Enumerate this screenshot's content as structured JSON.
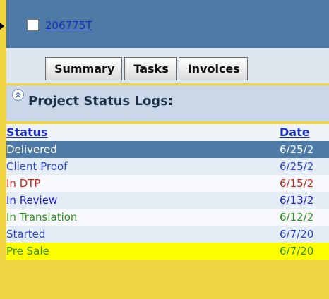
{
  "header": {
    "project_id": "206775T"
  },
  "tabs": [
    {
      "label": "Summary"
    },
    {
      "label": "Tasks"
    },
    {
      "label": "Invoices"
    }
  ],
  "panel": {
    "title": "Project Status Logs:"
  },
  "table": {
    "columns": [
      "Status",
      "Date"
    ],
    "rows": [
      {
        "status": "Delivered",
        "date": "6/25/2",
        "color": "#ffffff"
      },
      {
        "status": "Client Proof",
        "date": "6/25/2",
        "color": "#2b46c7"
      },
      {
        "status": "In DTP",
        "date": "6/15/2",
        "color": "#c0281a"
      },
      {
        "status": "In Review",
        "date": "6/13/2",
        "color": "#1b1fd0"
      },
      {
        "status": "In Translation",
        "date": "6/12/2",
        "color": "#2f8f1c"
      },
      {
        "status": "Started",
        "date": "6/7/20",
        "color": "#2b46c7"
      },
      {
        "status": "Pre Sale",
        "date": "6/7/20",
        "color": "#2f8f1c"
      }
    ]
  },
  "colors": {
    "page_background": "#f2d542",
    "header_bar": "#4e7aa6",
    "link": "#1a2fbf",
    "selected_row": "#4e7aa6",
    "highlight_row": "#ffff00"
  }
}
